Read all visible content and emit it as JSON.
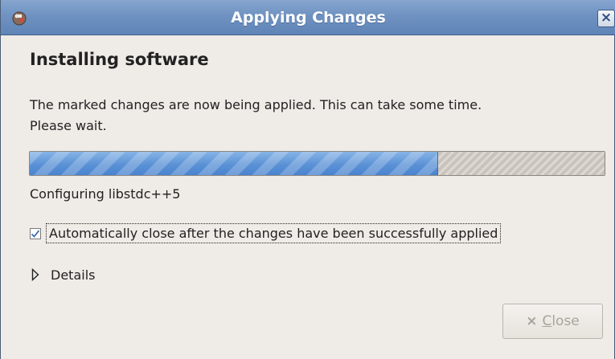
{
  "window": {
    "title": "Applying Changes",
    "close_glyph": "×",
    "icon": "package-manager-icon"
  },
  "content": {
    "heading": "Installing software",
    "message": "The marked changes are now being applied. This can take some time. Please wait.",
    "progress_fraction": 0.71,
    "status": "Configuring libstdc++5"
  },
  "options": {
    "auto_close_label": "Automatically close after the changes have been successfully applied",
    "auto_close_checked": true
  },
  "details": {
    "label": "Details",
    "expanded": false
  },
  "buttons": {
    "close_mnemonic": "C",
    "close_rest": "lose",
    "close_icon": "×",
    "close_enabled": false
  },
  "colors": {
    "titlebar": "#6f92c1",
    "progress_fill": "#5b92d6",
    "background": "#efebe7"
  }
}
